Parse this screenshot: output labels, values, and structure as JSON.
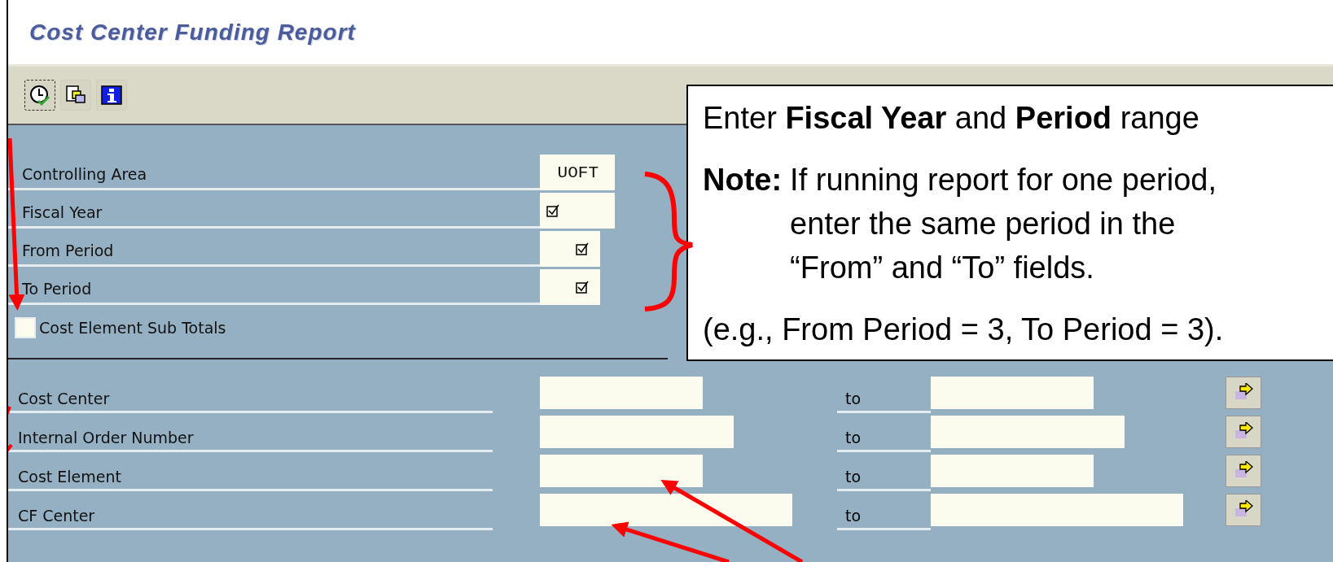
{
  "window": {
    "title": "Cost Center Funding Report"
  },
  "toolbar": [
    {
      "kind": "execute"
    },
    {
      "kind": "variants"
    },
    {
      "kind": "info"
    }
  ],
  "parameters": [
    {
      "label": "Controlling Area",
      "value": "UOFT",
      "required": false
    },
    {
      "label": "Fiscal Year",
      "required": true
    },
    {
      "label": "From Period",
      "required": true
    },
    {
      "label": "To Period",
      "required": true
    }
  ],
  "subtotals_checkbox": {
    "label": "Cost Element Sub Totals",
    "checked": false
  },
  "ranges": [
    {
      "label": "Cost Center",
      "to_label": "to"
    },
    {
      "label": "Internal Order Number",
      "to_label": "to"
    },
    {
      "label": "Cost Element",
      "to_label": "to"
    },
    {
      "label": "CF Center",
      "to_label": "to"
    }
  ],
  "callout": {
    "heading": "Enter **Fiscal Year** and **Period** range",
    "note_label": "Note:",
    "note_lines": [
      "If running report for one period,",
      "enter the same period in the",
      "“From” and “To” fields."
    ],
    "example": "(e.g., From Period = 3, To Period = 3)."
  }
}
